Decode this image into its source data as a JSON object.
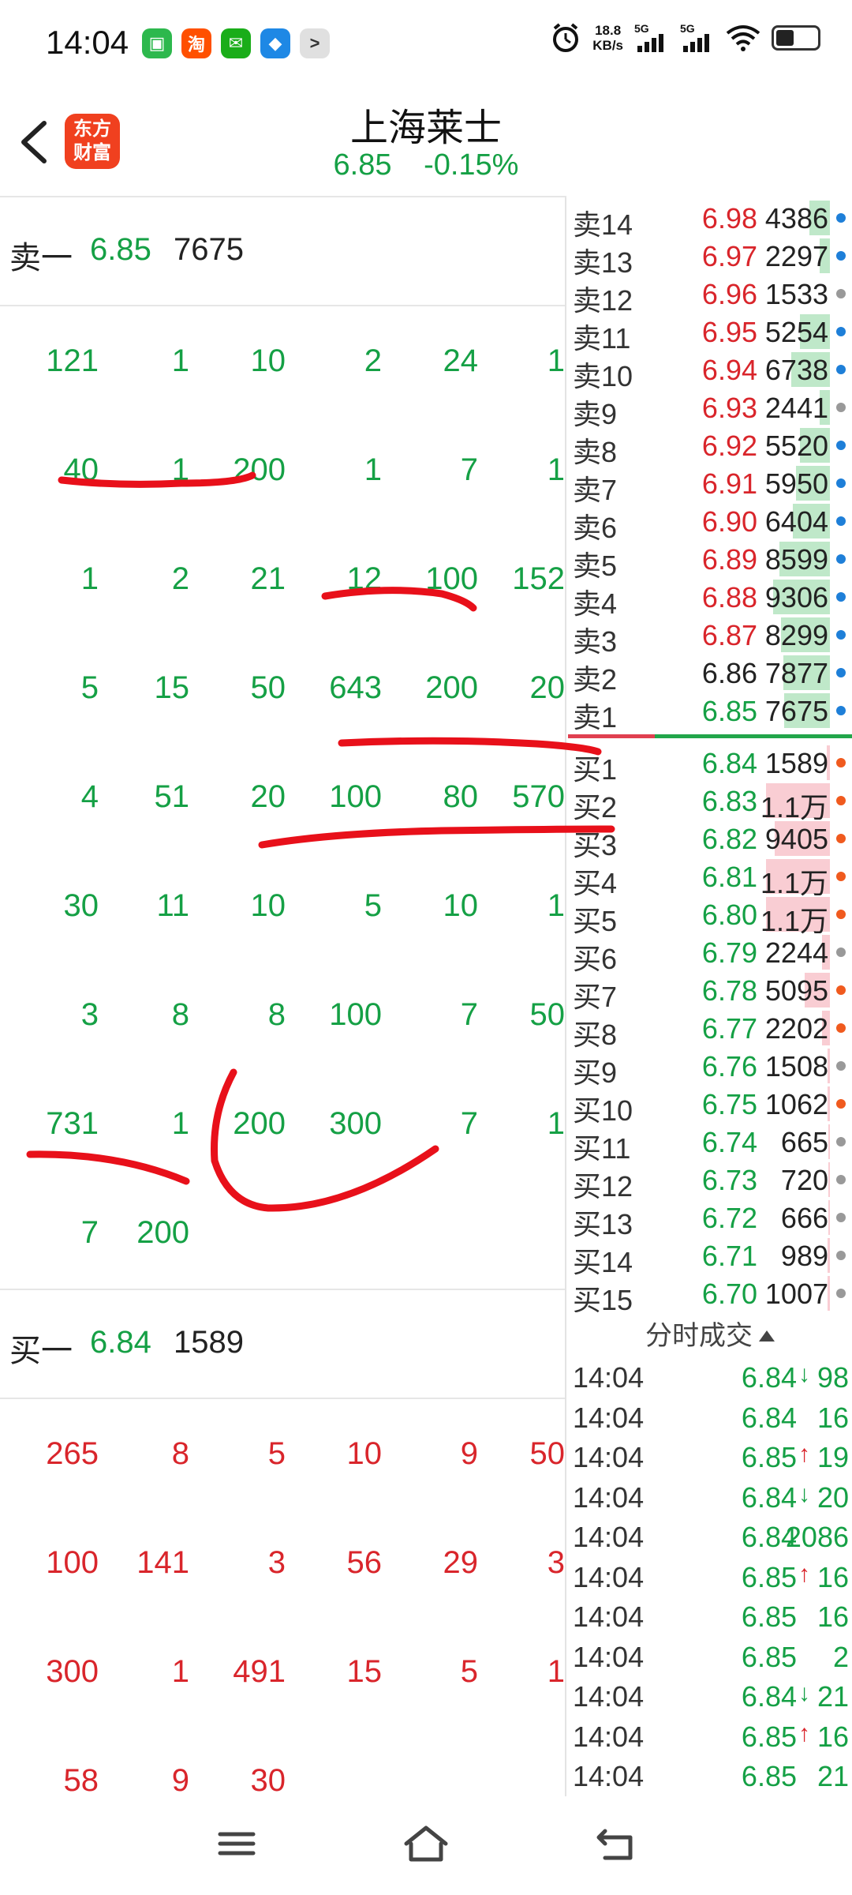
{
  "status_bar": {
    "time": "14:04",
    "apps": [
      {
        "icon": "calendar-app-icon",
        "glyph": "▣",
        "color": "#2db84d"
      },
      {
        "icon": "taobao-app-icon",
        "glyph": "淘",
        "color": "#ff5000"
      },
      {
        "icon": "wechat-app-icon",
        "glyph": "✉",
        "color": "#1aad19"
      },
      {
        "icon": "chat-app-icon",
        "glyph": "◆",
        "color": "#1e88e5"
      },
      {
        "icon": "terminal-app-icon",
        "glyph": ">",
        "color": "#e0e0e0"
      }
    ],
    "net_speed_value": "18.8",
    "net_speed_unit": "KB/s",
    "signal1_label": "5G",
    "signal2_label": "5G"
  },
  "header": {
    "title": "上海莱士",
    "price": "6.85",
    "change": "-0.15%",
    "logo_line1": "东方",
    "logo_line2": "财富",
    "brand_color": "#f0401f"
  },
  "sell_best": {
    "label": "卖一",
    "price": "6.85",
    "volume": "7675"
  },
  "sell_queue": [
    [
      "121",
      "1",
      "10",
      "2",
      "24",
      "1"
    ],
    [
      "40",
      "1",
      "200",
      "1",
      "7",
      "1"
    ],
    [
      "1",
      "2",
      "21",
      "12",
      "100",
      "152"
    ],
    [
      "5",
      "15",
      "50",
      "643",
      "200",
      "20"
    ],
    [
      "4",
      "51",
      "20",
      "100",
      "80",
      "570"
    ],
    [
      "30",
      "11",
      "10",
      "5",
      "10",
      "1"
    ],
    [
      "3",
      "8",
      "8",
      "100",
      "7",
      "50"
    ],
    [
      "731",
      "1",
      "200",
      "300",
      "7",
      "1"
    ],
    [
      "7",
      "200",
      "",
      "",
      "",
      ""
    ]
  ],
  "buy_best": {
    "label": "买一",
    "price": "6.84",
    "volume": "1589"
  },
  "buy_queue": [
    [
      "265",
      "8",
      "5",
      "10",
      "9",
      "50"
    ],
    [
      "100",
      "141",
      "3",
      "56",
      "29",
      "3"
    ],
    [
      "300",
      "1",
      "491",
      "15",
      "5",
      "1"
    ],
    [
      "58",
      "9",
      "30",
      "",
      "",
      ""
    ]
  ],
  "order_book": {
    "asks": [
      {
        "label": "卖14",
        "price": "6.98",
        "volume": "4386",
        "bar": 0.3,
        "dot": "#1e7fd8"
      },
      {
        "label": "卖13",
        "price": "6.97",
        "volume": "2297",
        "bar": 0.15,
        "dot": "#1e7fd8"
      },
      {
        "label": "卖12",
        "price": "6.96",
        "volume": "1533",
        "bar": 0.0,
        "dot": "#999999"
      },
      {
        "label": "卖11",
        "price": "6.95",
        "volume": "5254",
        "bar": 0.45,
        "dot": "#1e7fd8"
      },
      {
        "label": "卖10",
        "price": "6.94",
        "volume": "6738",
        "bar": 0.58,
        "dot": "#1e7fd8"
      },
      {
        "label": "卖9",
        "price": "6.93",
        "volume": "2441",
        "bar": 0.15,
        "dot": "#999999"
      },
      {
        "label": "卖8",
        "price": "6.92",
        "volume": "5520",
        "bar": 0.45,
        "dot": "#1e7fd8"
      },
      {
        "label": "卖7",
        "price": "6.91",
        "volume": "5950",
        "bar": 0.5,
        "dot": "#1e7fd8"
      },
      {
        "label": "卖6",
        "price": "6.90",
        "volume": "6404",
        "bar": 0.55,
        "dot": "#1e7fd8"
      },
      {
        "label": "卖5",
        "price": "6.89",
        "volume": "8599",
        "bar": 0.75,
        "dot": "#1e7fd8"
      },
      {
        "label": "卖4",
        "price": "6.88",
        "volume": "9306",
        "bar": 0.85,
        "dot": "#1e7fd8"
      },
      {
        "label": "卖3",
        "price": "6.87",
        "volume": "8299",
        "bar": 0.73,
        "dot": "#1e7fd8"
      },
      {
        "label": "卖2",
        "price": "6.86",
        "volume": "7877",
        "bar": 0.7,
        "dot": "#1e7fd8"
      },
      {
        "label": "卖1",
        "price": "6.85",
        "volume": "7675",
        "bar": 0.68,
        "dot": "#1e7fd8"
      }
    ],
    "bids": [
      {
        "label": "买1",
        "price": "6.84",
        "volume": "1589",
        "bar": 0.05,
        "dot": "#f05a1e"
      },
      {
        "label": "买2",
        "price": "6.83",
        "volume": "1.1万",
        "bar": 0.95,
        "dot": "#f05a1e"
      },
      {
        "label": "买3",
        "price": "6.82",
        "volume": "9405",
        "bar": 0.82,
        "dot": "#f05a1e"
      },
      {
        "label": "买4",
        "price": "6.81",
        "volume": "1.1万",
        "bar": 0.95,
        "dot": "#f05a1e"
      },
      {
        "label": "买5",
        "price": "6.80",
        "volume": "1.1万",
        "bar": 0.95,
        "dot": "#f05a1e"
      },
      {
        "label": "买6",
        "price": "6.79",
        "volume": "2244",
        "bar": 0.12,
        "dot": "#999999"
      },
      {
        "label": "买7",
        "price": "6.78",
        "volume": "5095",
        "bar": 0.38,
        "dot": "#f05a1e"
      },
      {
        "label": "买8",
        "price": "6.77",
        "volume": "2202",
        "bar": 0.12,
        "dot": "#f05a1e"
      },
      {
        "label": "买9",
        "price": "6.76",
        "volume": "1508",
        "bar": 0.03,
        "dot": "#999999"
      },
      {
        "label": "买10",
        "price": "6.75",
        "volume": "1062",
        "bar": 0.03,
        "dot": "#f05a1e"
      },
      {
        "label": "买11",
        "price": "6.74",
        "volume": "665",
        "bar": 0.02,
        "dot": "#999999"
      },
      {
        "label": "买12",
        "price": "6.73",
        "volume": "720",
        "bar": 0.02,
        "dot": "#999999"
      },
      {
        "label": "买13",
        "price": "6.72",
        "volume": "666",
        "bar": 0.02,
        "dot": "#999999"
      },
      {
        "label": "买14",
        "price": "6.71",
        "volume": "989",
        "bar": 0.03,
        "dot": "#999999"
      },
      {
        "label": "买15",
        "price": "6.70",
        "volume": "1007",
        "bar": 0.03,
        "dot": "#999999"
      }
    ]
  },
  "trades": {
    "title": "分时成交",
    "rows": [
      {
        "time": "14:04",
        "price": "6.84",
        "dir": "down",
        "volume": "98"
      },
      {
        "time": "14:04",
        "price": "6.84",
        "dir": "",
        "volume": "16"
      },
      {
        "time": "14:04",
        "price": "6.85",
        "dir": "up",
        "volume": "19"
      },
      {
        "time": "14:04",
        "price": "6.84",
        "dir": "down",
        "volume": "20"
      },
      {
        "time": "14:04",
        "price": "6.84",
        "dir": "",
        "volume": "2086"
      },
      {
        "time": "14:04",
        "price": "6.85",
        "dir": "up",
        "volume": "16"
      },
      {
        "time": "14:04",
        "price": "6.85",
        "dir": "",
        "volume": "16"
      },
      {
        "time": "14:04",
        "price": "6.85",
        "dir": "",
        "volume": "2"
      },
      {
        "time": "14:04",
        "price": "6.84",
        "dir": "down",
        "volume": "21"
      },
      {
        "time": "14:04",
        "price": "6.85",
        "dir": "up",
        "volume": "16"
      },
      {
        "time": "14:04",
        "price": "6.85",
        "dir": "",
        "volume": "21"
      }
    ]
  },
  "colors": {
    "up_red": "#d9252b",
    "down_green": "#15a045",
    "neutral": "#222222",
    "ask_bar": "#bfe8c9",
    "bid_bar": "#f9cdd3",
    "ink_red": "#e8101a"
  },
  "navbar": {
    "icons": [
      "menu-icon",
      "home-icon",
      "back-icon"
    ]
  }
}
